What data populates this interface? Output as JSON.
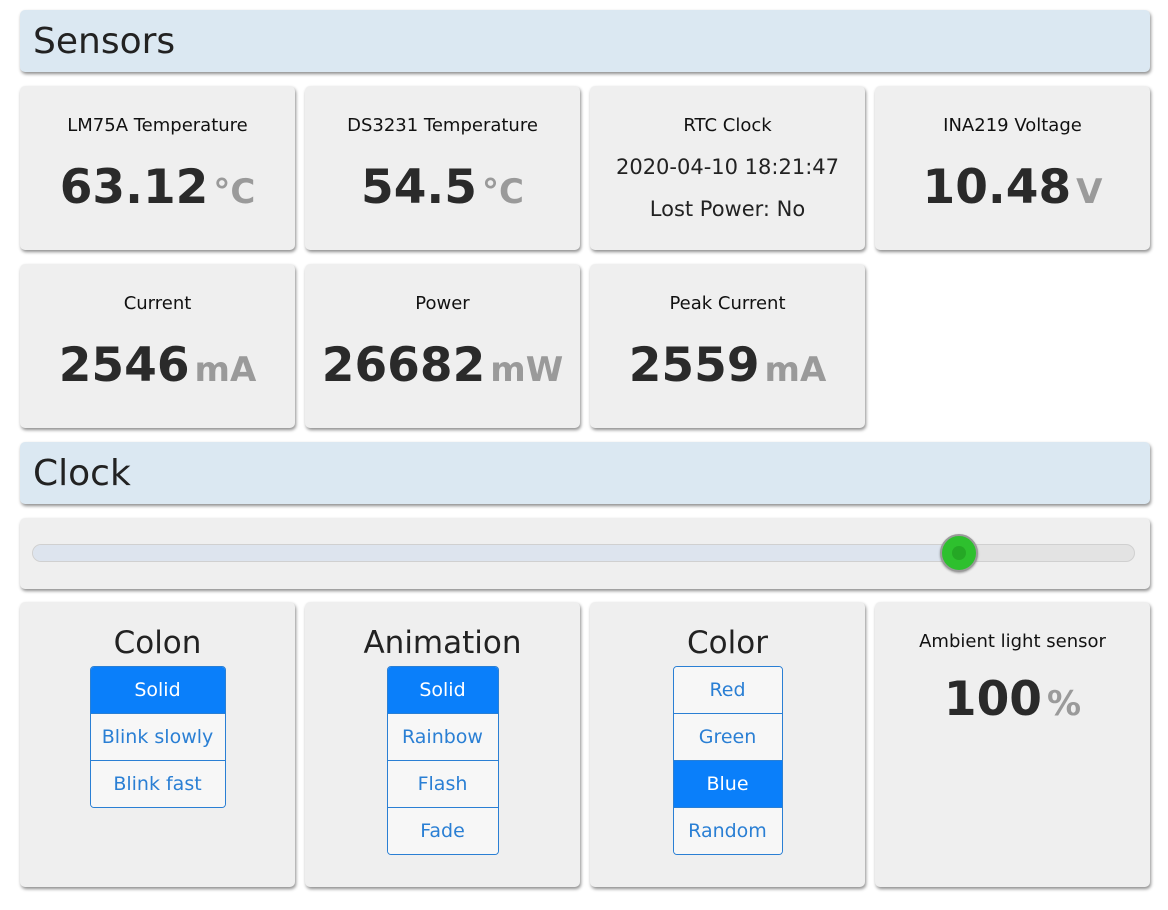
{
  "sensors_section": {
    "title": "Sensors"
  },
  "sensors": {
    "lm75a": {
      "title": "LM75A Temperature",
      "value": "63.12",
      "unit": "°C"
    },
    "ds3231": {
      "title": "DS3231 Temperature",
      "value": "54.5",
      "unit": "°C"
    },
    "rtc": {
      "title": "RTC Clock",
      "datetime": "2020-04-10 18:21:47",
      "lost_power": "Lost Power: No"
    },
    "ina219_voltage": {
      "title": "INA219 Voltage",
      "value": "10.48",
      "unit": "V"
    },
    "current": {
      "title": "Current",
      "value": "2546",
      "unit": "mA"
    },
    "power": {
      "title": "Power",
      "value": "26682",
      "unit": "mW"
    },
    "peak_current": {
      "title": "Peak Current",
      "value": "2559",
      "unit": "mA"
    }
  },
  "clock_section": {
    "title": "Clock"
  },
  "brightness_slider": {
    "value_fraction": 0.84,
    "thumb_color": "#2ec02e"
  },
  "colon": {
    "title": "Colon",
    "options": [
      "Solid",
      "Blink slowly",
      "Blink fast"
    ],
    "selected": "Solid"
  },
  "animation": {
    "title": "Animation",
    "options": [
      "Solid",
      "Rainbow",
      "Flash",
      "Fade"
    ],
    "selected": "Solid"
  },
  "color": {
    "title": "Color",
    "options": [
      "Red",
      "Green",
      "Blue",
      "Random"
    ],
    "selected": "Blue"
  },
  "ambient": {
    "title": "Ambient light sensor",
    "value": "100",
    "unit": "%"
  },
  "theme": {
    "accent": "#0a7ffa",
    "link": "#2a7fd4",
    "header_bg": "#dbe8f2",
    "card_bg": "#efefef"
  }
}
